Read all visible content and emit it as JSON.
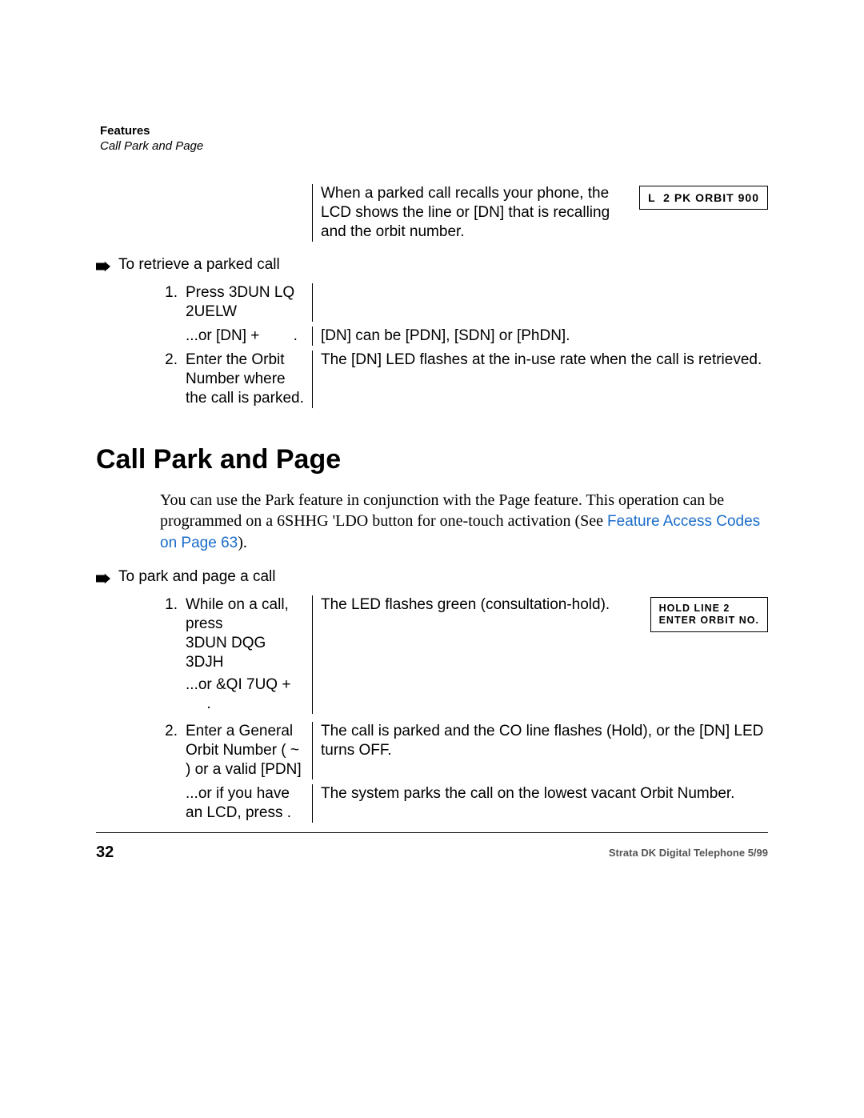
{
  "header": {
    "chapter": "Features",
    "section": "Call Park and Page"
  },
  "recall": {
    "text": "When a parked call recalls your phone, the LCD shows the line or [DN] that is recalling and the orbit number.",
    "lcd": "L  2 PK ORBIT 900"
  },
  "retrieve": {
    "title": "To retrieve a parked call",
    "step1_left": "Press 3DUN LQ 2UELW",
    "step1b_left": "...or [DN] +        .",
    "step1b_right": "[DN] can be [PDN], [SDN] or [PhDN].",
    "step2_left": "Enter the Orbit Number where the call is parked.",
    "step2_right": "The [DN] LED flashes at the in-use rate when the call is retrieved."
  },
  "heading": "Call Park and Page",
  "intro": {
    "part1": "You can use the Park feature in conjunction with the Page feature. This operation can be programmed on a 6SHHG 'LDO button for one-touch activation (See ",
    "link": "Feature Access Codes on Page 63",
    "part2": ")."
  },
  "park_page": {
    "title": "To park and page a call",
    "step1_left_a": "While on a call, press",
    "step1_left_b": "3DUN DQG 3DJH",
    "step1_left_c": "...or &QI 7UQ +",
    "step1_left_d": "     .",
    "step1_right": "The LED flashes green (consultation-hold).",
    "step1_lcd": "HOLD LINE 2\nENTER ORBIT NO.",
    "step2_left_a": "Enter a General Orbit Number (     ~      ) or a valid [PDN]",
    "step2_right_a": "The call is parked and the CO line flashes (Hold), or the [DN] LED turns OFF.",
    "step2_left_b": "...or if you have an LCD, press      .",
    "step2_right_b": "The system parks the call on the lowest vacant Orbit Number."
  },
  "footer": {
    "page": "32",
    "right": "Strata DK Digital Telephone   5/99"
  }
}
